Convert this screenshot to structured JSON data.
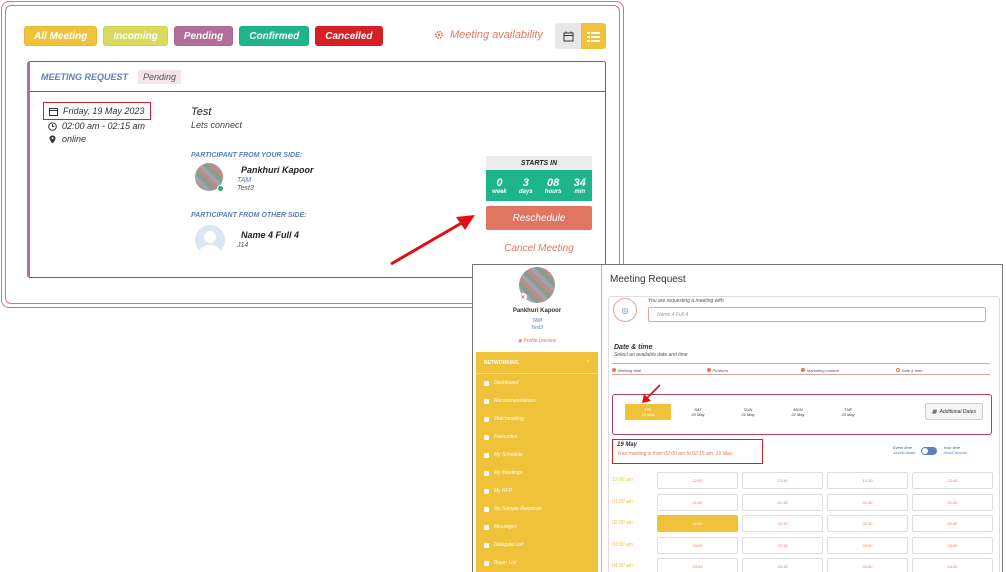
{
  "filters": [
    {
      "label": "All Meeting",
      "color": "#f0c23a"
    },
    {
      "label": "Incoming",
      "color": "#d9db5c"
    },
    {
      "label": "Pending",
      "color": "#b36d9b"
    },
    {
      "label": "Confirmed",
      "color": "#1fb58a"
    },
    {
      "label": "Cancelled",
      "color": "#d81f26"
    }
  ],
  "meeting_availability": "Meeting availability",
  "card": {
    "title": "MEETING REQUEST",
    "status": "Pending",
    "date": "Friday, 19 May 2023",
    "time": "02:00 am - 02:15 am",
    "location": "online",
    "meeting_title": "Test",
    "meeting_desc": "Lets connect",
    "your_side_label": "PARTICIPANT FROM YOUR SIDE:",
    "your_name": "Pankhuri Kapoor",
    "your_role": "TAM",
    "your_company": "Test3",
    "other_side_label": "PARTICIPANT FROM OTHER SIDE:",
    "other_name": "Name 4 Full 4",
    "other_company": "J14",
    "starts_in_label": "STARTS IN",
    "countdown": [
      {
        "n": "0",
        "u": "week"
      },
      {
        "n": "3",
        "u": "days"
      },
      {
        "n": "08",
        "u": "hours"
      },
      {
        "n": "34",
        "u": "min"
      }
    ],
    "reschedule": "Reschedule",
    "cancel": "Cancel Meeting"
  },
  "right": {
    "profile_name": "Pankhuri Kapoor",
    "profile_role": "TAM",
    "profile_company": "Test3",
    "profile_preview": "Profile preview",
    "nav_head": "NETWORKING",
    "nav": [
      "Dashboard",
      "Recommendations",
      "Matchmaking",
      "Favourites",
      "My Schedule",
      "My Meetings",
      "My RFP",
      "My Sample Requests",
      "Messages",
      "Delegate List",
      "Buyer List"
    ],
    "title": "Meeting Request",
    "requesting_label": "You are requesting a meeting with",
    "requesting_value": "Name 4 Full 4",
    "dt_title": "Date & time",
    "dt_sub": "Select an available date and time",
    "steps": [
      "Meeting date",
      "Products",
      "Marketing content",
      "Date & time"
    ],
    "dates": [
      {
        "d": "FRI",
        "m": "19 May"
      },
      {
        "d": "SAT",
        "m": "20 May"
      },
      {
        "d": "SUN",
        "m": "21 May"
      },
      {
        "d": "MON",
        "m": "22 May"
      },
      {
        "d": "TUE",
        "m": "23 May"
      }
    ],
    "additional_dates": "Additional Dates",
    "sel_date": "19 May",
    "sel_text": "Your meeting is from 02:00 am to 02:15 am, 19 May",
    "event_time_label": "Event time",
    "event_time_tz": "Asia/Kolkata",
    "your_time_label": "Your time",
    "your_time_tz": "Asia/Calcutta",
    "slots": [
      {
        "t": "12:00 am",
        "v": [
          "12:00",
          "12:15",
          "12:30",
          "12:45"
        ]
      },
      {
        "t": "01:00 am",
        "v": [
          "01:00",
          "01:15",
          "01:30",
          "01:45"
        ]
      },
      {
        "t": "02:00 am",
        "v": [
          "02:00",
          "02:15",
          "02:30",
          "02:45"
        ]
      },
      {
        "t": "03:00 am",
        "v": [
          "03:00",
          "03:15",
          "03:30",
          "03:45"
        ]
      },
      {
        "t": "04:00 am",
        "v": [
          "04:00",
          "04:15",
          "04:30",
          "04:45"
        ]
      }
    ]
  }
}
